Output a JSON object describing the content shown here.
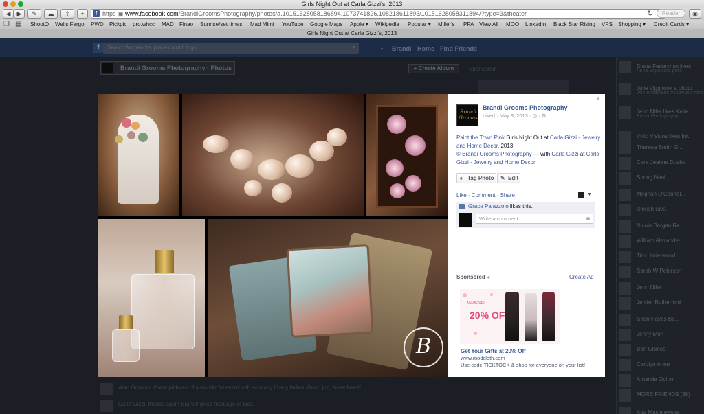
{
  "browser": {
    "window_title": "Girls Night Out at Carla Gizzi's, 2013",
    "url_scheme": "https",
    "url_host": "www.facebook.com",
    "url_path": "/BrandiGroomsPhotography/photos/a.10151628058186894.1073741826.108218611893/10151628058311894/?type=3&theater",
    "reader_label": "Reader",
    "tab_title": "Girls Night Out at Carla Gizzi's, 2013",
    "bookmarks": [
      "ShootQ",
      "Wells Fargo",
      "PWD",
      "Pickpic",
      "pro.whcc",
      "MAD",
      "Finao",
      "Sunrise/set times",
      "Mad Mimi",
      "YouTube",
      "Google Maps",
      "Apple ▾",
      "Wikipedia",
      "Popular ▾",
      "Miller's",
      "PPA",
      "View All",
      "MOO",
      "LinkedIn",
      "Black Star Rising",
      "VPS",
      "Shopping ▾",
      "Credit Cards ▾"
    ]
  },
  "background_page": {
    "search_placeholder": "Search for people, places and things",
    "nav_home": "Home",
    "nav_find": "Find Friends",
    "page_name": "Brandi Grooms Photography",
    "section": "Photos",
    "create_album": "+ Create Album",
    "sponsored_small": "Sponsored",
    "comments": [
      "Alan Grooms: Great pictures of a wonderful event with so many lovely ladies. Good job, sweetheart!",
      "Carla Gizzi: thanks again Brandi! great montage of pics."
    ]
  },
  "chat": [
    {
      "name": "Diana Federchuk likes",
      "sub": "Anna Shpolski's post."
    },
    {
      "name": "Julie Vigg took a photo",
      "sub": "with Instagram. #sidewalk #photoshop"
    },
    {
      "name": "Jenn Nifer likes Katie",
      "sub": "Porter Photography"
    },
    {
      "name": "Vivid Visions likes Ink.",
      "sub": ""
    },
    {
      "name": "Theresa Smith G...",
      "sub": ""
    },
    {
      "name": "Cara Jeanne Dusbe",
      "sub": ""
    },
    {
      "name": "Spring Neal",
      "sub": ""
    },
    {
      "name": "Meghan O'Connel...",
      "sub": ""
    },
    {
      "name": "Dinesh Siva",
      "sub": ""
    },
    {
      "name": "Nicole Bergan Re...",
      "sub": ""
    },
    {
      "name": "William Alexander",
      "sub": ""
    },
    {
      "name": "Tim Underwood",
      "sub": ""
    },
    {
      "name": "Sarah W Peterson",
      "sub": ""
    },
    {
      "name": "Jenn Nifer",
      "sub": ""
    },
    {
      "name": "Jenifer Rutherford",
      "sub": ""
    },
    {
      "name": "Shari Hayes Be...",
      "sub": ""
    },
    {
      "name": "Jenny Moh",
      "sub": ""
    },
    {
      "name": "Ben Grimes",
      "sub": ""
    },
    {
      "name": "Carolyn Anne",
      "sub": ""
    },
    {
      "name": "Amanda Quinn",
      "sub": ""
    },
    {
      "name": "MORE FRIENDS (58)",
      "sub": ""
    },
    {
      "name": "Aga Maciejewska",
      "sub": ""
    }
  ],
  "photo": {
    "watermark_letter": "B",
    "watermark_text": "BRANDIGROOMS PHOTOGRAPHY"
  },
  "panel": {
    "close_label": "×",
    "page_logo_text": "Brandi Grooms",
    "page_name": "Brandi Grooms Photography",
    "meta": "Liked · May 8, 2013 · ◷ · ⚙",
    "caption_link1": "Paint the Town Pink",
    "caption_text1": " Girls Night Out at ",
    "caption_link2": "Carla Gizzi - Jewelry and Home Decor",
    "caption_text2": ", 2013",
    "credit_text1": "© Brandi Grooms Photography",
    "credit_text2": " — with ",
    "credit_link1": "Carla Gizzi",
    "credit_text3": " at ",
    "credit_link2": "Carla Gizzi - Jewelry and Home Decor.",
    "tag_photo": "Tag Photo",
    "edit": "Edit",
    "like": "Like",
    "comment": "Comment",
    "share": "Share",
    "likes_name": "Grace Palazzolo",
    "likes_text": " likes this.",
    "comment_placeholder": "Write a comment...",
    "sponsored": "Sponsored",
    "create_ad": "Create Ad",
    "ad_brand": "ModCloth",
    "ad_offer": "20% OFF",
    "ad_title": "Get Your Gifts at 20% Off",
    "ad_url": "www.modcloth.com",
    "ad_desc": "Use code TICKTOCK & shop for everyone on your list!"
  },
  "colors": {
    "facebook_blue": "#3b5998",
    "ad_pink": "#e04d76"
  }
}
